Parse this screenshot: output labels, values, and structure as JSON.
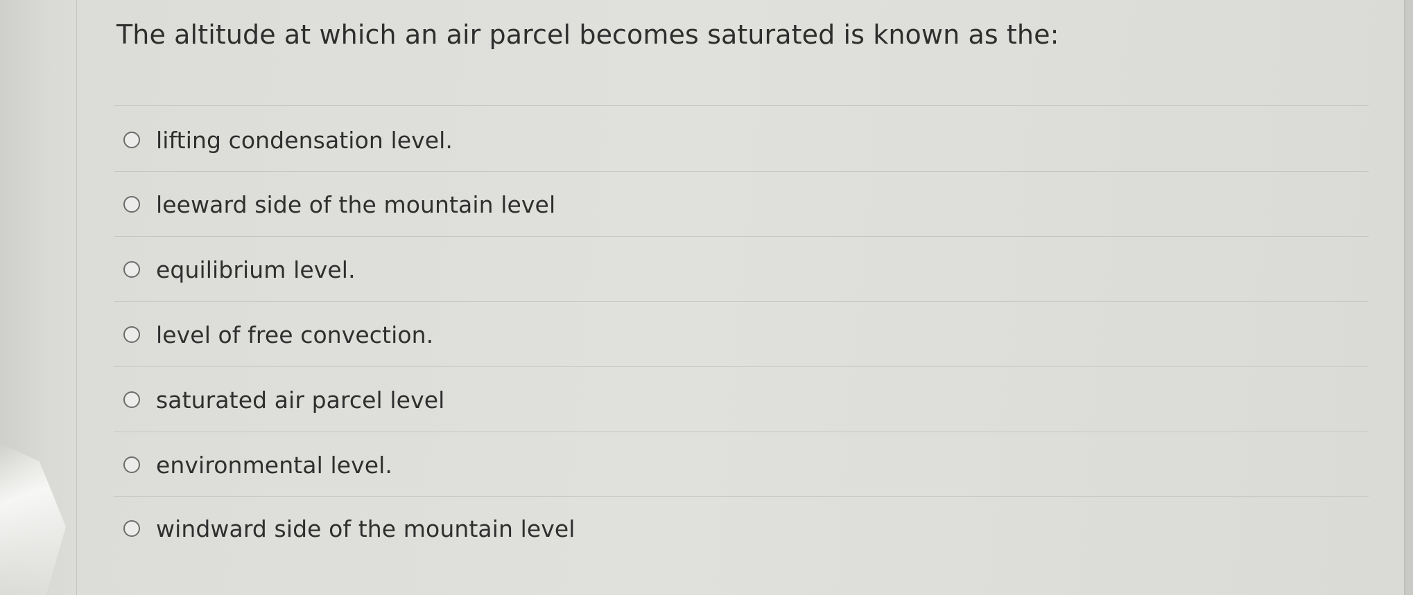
{
  "question": {
    "text": "The altitude at which an air parcel becomes saturated is known as the:"
  },
  "options": [
    {
      "label": "lifting condensation level.",
      "selected": false
    },
    {
      "label": "leeward side of the mountain level",
      "selected": false
    },
    {
      "label": "equilibrium level.",
      "selected": false
    },
    {
      "label": "level of free convection.",
      "selected": false
    },
    {
      "label": "saturated air parcel level",
      "selected": false
    },
    {
      "label": "environmental level.",
      "selected": false
    },
    {
      "label": "windward side of the mountain level",
      "selected": false
    }
  ],
  "colors": {
    "card_background": "#e0e0dc",
    "text": "#2e2e2e",
    "radio_border": "#6b6b6b",
    "divider": "#c6c6c2"
  }
}
